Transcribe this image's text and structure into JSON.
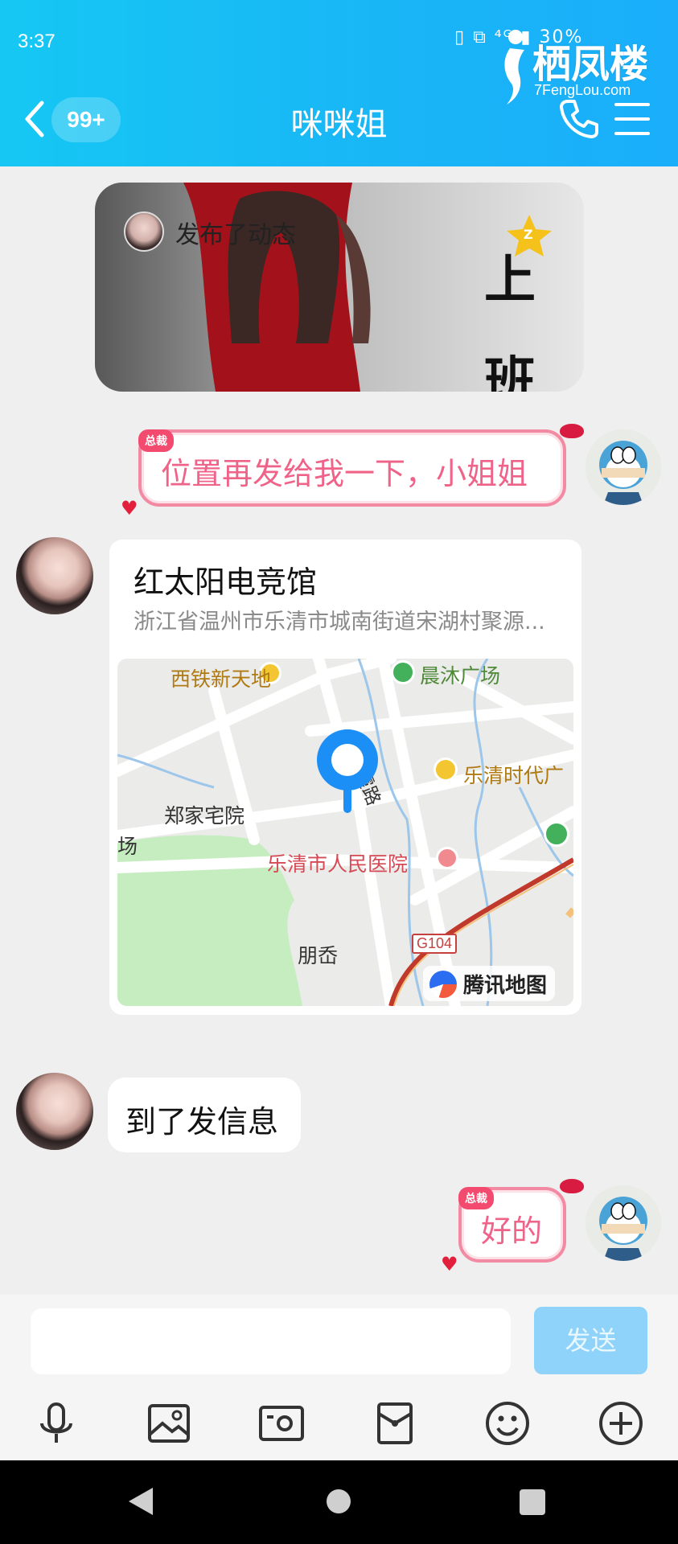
{
  "status_bar": {
    "time": "3:37",
    "icons_text": "▯ ⧉ ⁴ᴳ ▮ 30%"
  },
  "watermark": {
    "title": "栖凤楼",
    "url": "7FengLou.com"
  },
  "header": {
    "badge": "99+",
    "title": "咪咪姐"
  },
  "feed_card": {
    "text": "发布了动态",
    "art_chars": [
      "上",
      "班"
    ],
    "star_label": "Z"
  },
  "messages": [
    {
      "side": "right",
      "tag": "总裁",
      "text": "位置再发给我一下，小姐姐"
    },
    {
      "side": "left",
      "type": "location",
      "name": "红太阳电竞馆",
      "address": "浙江省温州市乐清市城南街道宋湖村聚源..."
    },
    {
      "side": "left",
      "text": "到了发信息"
    },
    {
      "side": "right",
      "tag": "总裁",
      "text": "好的"
    }
  ],
  "map": {
    "labels": {
      "xitie": "西铁新天地",
      "chenmu": "晨沐广场",
      "danxia": "丹霞路",
      "zhengjia": "郑家宅院",
      "chang": "场",
      "yueqing_times": "乐清时代广",
      "hospital": "乐清市人民医院",
      "pengdan": "朋岙",
      "road": "G104"
    },
    "brand": "腾讯地图"
  },
  "input": {
    "placeholder": "",
    "send_label": "发送"
  },
  "toolbar": {
    "icons": [
      "microphone-icon",
      "image-icon",
      "camera-icon",
      "red-packet-icon",
      "emoji-icon",
      "plus-icon"
    ]
  },
  "colors": {
    "header": "#19b5f6",
    "pink": "#ef6389",
    "send": "#8fd3fb"
  }
}
